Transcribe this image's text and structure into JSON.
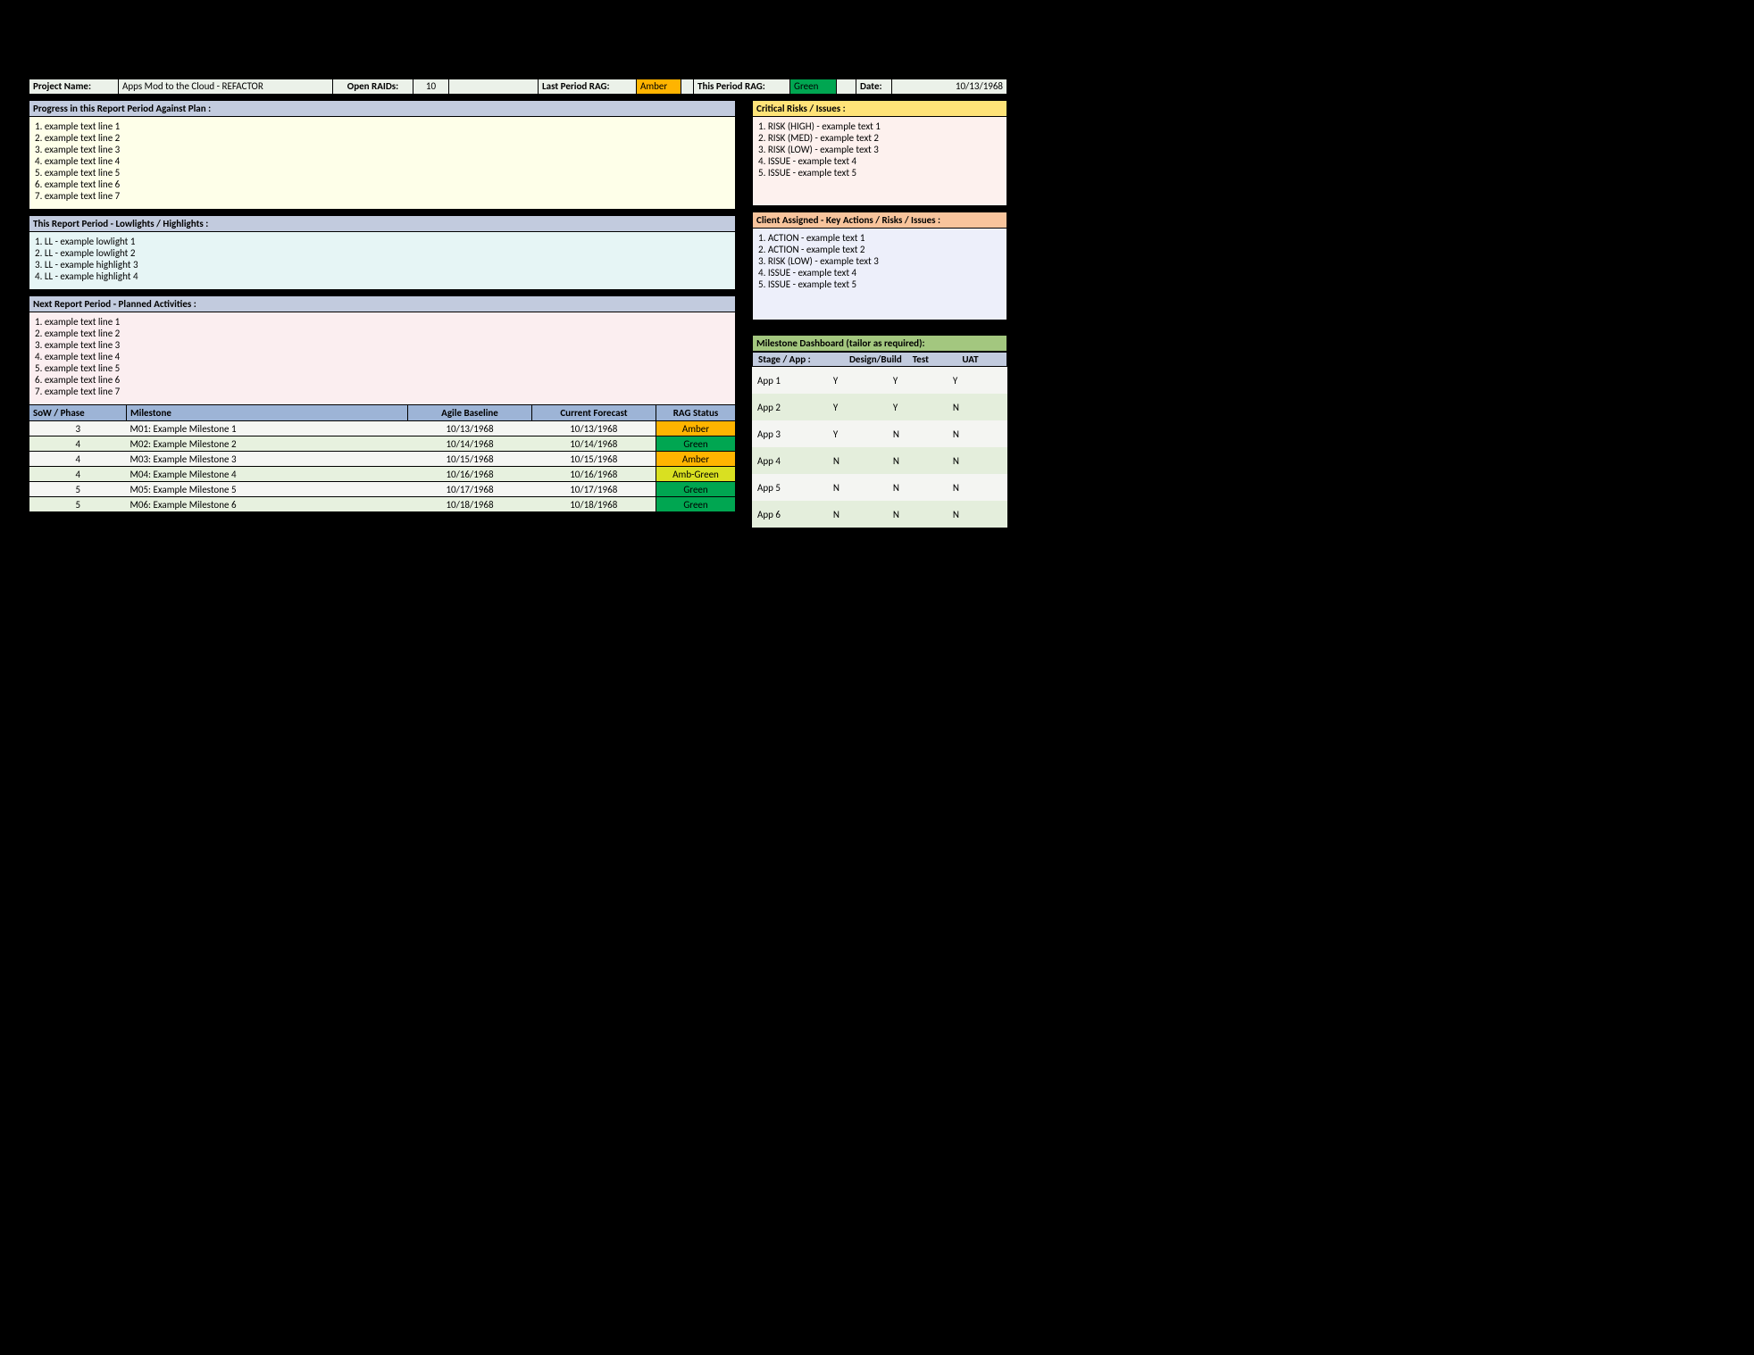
{
  "header": {
    "projectNameLabel": "Project Name:",
    "projectName": "Apps Mod to the Cloud - REFACTOR",
    "openRaidsLabel": "Open RAIDs:",
    "openRaids": "10",
    "lastRagLabel": "Last Period RAG:",
    "lastRag": "Amber",
    "thisRagLabel": "This Period RAG:",
    "thisRag": "Green",
    "dateLabel": "Date:",
    "date": "10/13/1968"
  },
  "sections": {
    "progressTitle": "Progress in this Report Period Against Plan :",
    "progress": [
      "1. example text line 1",
      "2. example text line 2",
      "3. example text line 3",
      "4. example text line 4",
      "5. example text line 5",
      "6. example text line 6",
      "7. example text line 7"
    ],
    "lowhighTitle": "This Report Period - Lowlights / Highlights :",
    "lowhigh": [
      "1. LL - example lowlight 1",
      "2. LL - example lowlight 2",
      "3. LL - example highlight 3",
      "4. LL - example highlight 4"
    ],
    "plannedTitle": "Next Report Period - Planned Activities :",
    "planned": [
      "1. example text line 1",
      "2. example text line 2",
      "3. example text line 3",
      "4. example text line 4",
      "5. example text line 5",
      "6. example text line 6",
      "7. example text line 7"
    ],
    "risksTitle": "Critical Risks / Issues :",
    "risks": [
      "1. RISK (HIGH) - example text 1",
      "2. RISK (MED) - example text 2",
      "3. RISK (LOW) - example text 3",
      "4. ISSUE - example text 4",
      "5. ISSUE - example text 5"
    ],
    "clientTitle": "Client Assigned - Key Actions / Risks / Issues :",
    "client": [
      "1. ACTION - example text 1",
      "2. ACTION - example text 2",
      "3. RISK (LOW) - example text 3",
      "4. ISSUE - example text 4",
      "5. ISSUE - example text 5"
    ]
  },
  "milestones": {
    "headers": {
      "sow": "SoW / Phase",
      "ms": "Milestone",
      "base": "Agile Baseline",
      "fcst": "Current Forecast",
      "rag": "RAG Status"
    },
    "rows": [
      {
        "sow": "3",
        "ms": "M01: Example Milestone 1",
        "base": "10/13/1968",
        "fcst": "10/13/1968",
        "rag": "Amber",
        "cls": "amber"
      },
      {
        "sow": "4",
        "ms": "M02: Example Milestone 2",
        "base": "10/14/1968",
        "fcst": "10/14/1968",
        "rag": "Green",
        "cls": "green"
      },
      {
        "sow": "4",
        "ms": "M03: Example Milestone 3",
        "base": "10/15/1968",
        "fcst": "10/15/1968",
        "rag": "Amber",
        "cls": "amber"
      },
      {
        "sow": "4",
        "ms": "M04: Example Milestone 4",
        "base": "10/16/1968",
        "fcst": "10/16/1968",
        "rag": "Amb-Green",
        "cls": "ambgreen"
      },
      {
        "sow": "5",
        "ms": "M05: Example Milestone 5",
        "base": "10/17/1968",
        "fcst": "10/17/1968",
        "rag": "Green",
        "cls": "green"
      },
      {
        "sow": "5",
        "ms": "M06: Example Milestone 6",
        "base": "10/18/1968",
        "fcst": "10/18/1968",
        "rag": "Green",
        "cls": "green"
      }
    ]
  },
  "dashboard": {
    "title": "Milestone Dashboard (tailor as required):",
    "headers": {
      "stage": "Stage / App :",
      "design": "Design/Build",
      "test": "Test",
      "uat": "UAT"
    },
    "rows": [
      {
        "app": "App 1",
        "design": "Y",
        "test": "Y",
        "uat": "Y"
      },
      {
        "app": "App 2",
        "design": "Y",
        "test": "Y",
        "uat": "N"
      },
      {
        "app": "App 3",
        "design": "Y",
        "test": "N",
        "uat": "N"
      },
      {
        "app": "App 4",
        "design": "N",
        "test": "N",
        "uat": "N"
      },
      {
        "app": "App 5",
        "design": "N",
        "test": "N",
        "uat": "N"
      },
      {
        "app": "App 6",
        "design": "N",
        "test": "N",
        "uat": "N"
      }
    ]
  }
}
